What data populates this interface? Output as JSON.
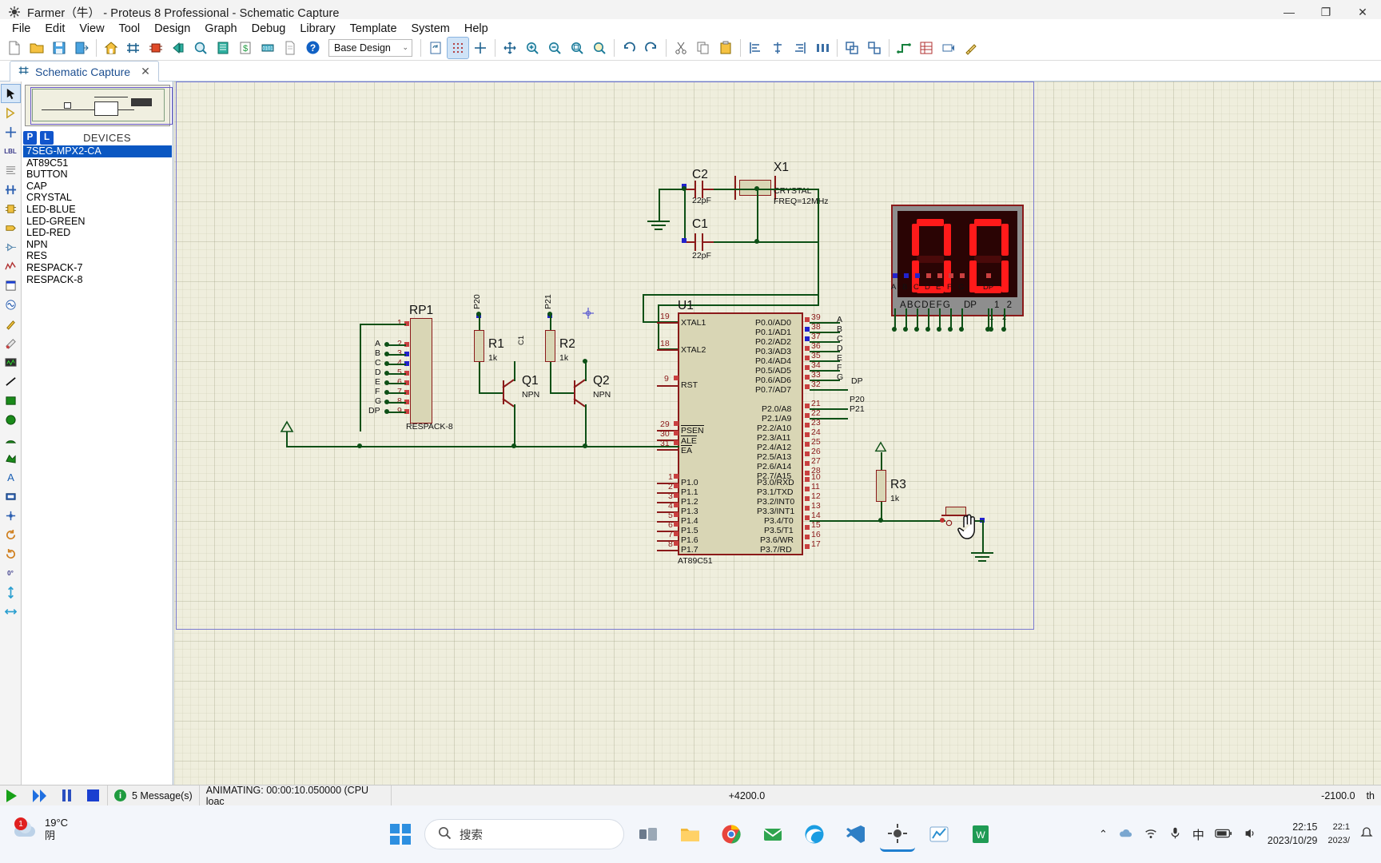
{
  "window": {
    "title": "Farmer（牛） - Proteus 8 Professional - Schematic Capture",
    "minimize": "—",
    "maximize": "❐",
    "close": "✕"
  },
  "menu": [
    "File",
    "Edit",
    "View",
    "Tool",
    "Design",
    "Graph",
    "Debug",
    "Library",
    "Template",
    "System",
    "Help"
  ],
  "toolbar": {
    "design_combo_value": "Base Design",
    "design_combo_arrow": "⌄"
  },
  "tab": {
    "label": "Schematic Capture",
    "close": "✕"
  },
  "panel": {
    "p_button": "P",
    "l_button": "L",
    "header": "DEVICES",
    "devices": [
      "7SEG-MPX2-CA",
      "AT89C51",
      "BUTTON",
      "CAP",
      "CRYSTAL",
      "LED-BLUE",
      "LED-GREEN",
      "LED-RED",
      "NPN",
      "RES",
      "RESPACK-7",
      "RESPACK-8"
    ],
    "selected_index": 0
  },
  "schematic": {
    "u1": {
      "ref": "U1",
      "value": "AT89C51",
      "left_pins": [
        {
          "num": "19",
          "name": "XTAL1"
        },
        {
          "num": "18",
          "name": "XTAL2"
        },
        {
          "num": "9",
          "name": "RST"
        },
        {
          "num": "29",
          "name": "PSEN"
        },
        {
          "num": "30",
          "name": "ALE"
        },
        {
          "num": "31",
          "name": "EA"
        },
        {
          "num": "1",
          "name": "P1.0"
        },
        {
          "num": "2",
          "name": "P1.1"
        },
        {
          "num": "3",
          "name": "P1.2"
        },
        {
          "num": "4",
          "name": "P1.3"
        },
        {
          "num": "5",
          "name": "P1.4"
        },
        {
          "num": "6",
          "name": "P1.5"
        },
        {
          "num": "7",
          "name": "P1.6"
        },
        {
          "num": "8",
          "name": "P1.7"
        }
      ],
      "port0": [
        {
          "num": "39",
          "name": "P0.0/AD0",
          "net": "A"
        },
        {
          "num": "38",
          "name": "P0.1/AD1",
          "net": "B"
        },
        {
          "num": "37",
          "name": "P0.2/AD2",
          "net": "C"
        },
        {
          "num": "36",
          "name": "P0.3/AD3",
          "net": "D"
        },
        {
          "num": "35",
          "name": "P0.4/AD4",
          "net": "E"
        },
        {
          "num": "34",
          "name": "P0.5/AD5",
          "net": "F"
        },
        {
          "num": "33",
          "name": "P0.6/AD6",
          "net": "G"
        },
        {
          "num": "32",
          "name": "P0.7/AD7",
          "net": "DP"
        }
      ],
      "port2": [
        {
          "num": "21",
          "name": "P2.0/A8",
          "net": "P20"
        },
        {
          "num": "22",
          "name": "P2.1/A9",
          "net": "P21"
        },
        {
          "num": "23",
          "name": "P2.2/A10",
          "net": ""
        },
        {
          "num": "24",
          "name": "P2.3/A11",
          "net": ""
        },
        {
          "num": "25",
          "name": "P2.4/A12",
          "net": ""
        },
        {
          "num": "26",
          "name": "P2.5/A13",
          "net": ""
        },
        {
          "num": "27",
          "name": "P2.6/A14",
          "net": ""
        },
        {
          "num": "28",
          "name": "P2.7/A15",
          "net": ""
        }
      ],
      "port3": [
        {
          "num": "10",
          "name": "P3.0/RXD"
        },
        {
          "num": "11",
          "name": "P3.1/TXD"
        },
        {
          "num": "12",
          "name": "P3.2/INT0"
        },
        {
          "num": "13",
          "name": "P3.3/INT1"
        },
        {
          "num": "14",
          "name": "P3.4/T0"
        },
        {
          "num": "15",
          "name": "P3.5/T1"
        },
        {
          "num": "16",
          "name": "P3.6/WR"
        },
        {
          "num": "17",
          "name": "P3.7/RD"
        }
      ]
    },
    "rp1": {
      "ref": "RP1",
      "value": "RESPACK-8",
      "pins": [
        {
          "num": "1",
          "net": ""
        },
        {
          "num": "2",
          "net": "A"
        },
        {
          "num": "3",
          "net": "B"
        },
        {
          "num": "4",
          "net": "C"
        },
        {
          "num": "5",
          "net": "D"
        },
        {
          "num": "6",
          "net": "E"
        },
        {
          "num": "7",
          "net": "F"
        },
        {
          "num": "8",
          "net": "G"
        },
        {
          "num": "9",
          "net": "DP"
        }
      ]
    },
    "c1": {
      "ref": "C1",
      "value": "22pF"
    },
    "c2": {
      "ref": "C2",
      "value": "22pF"
    },
    "x1": {
      "ref": "X1",
      "value": "CRYSTAL",
      "freq": "FREQ=12MHz"
    },
    "r1": {
      "ref": "R1",
      "value": "1k"
    },
    "r2": {
      "ref": "R2",
      "value": "1k"
    },
    "r3": {
      "ref": "R3",
      "value": "1k"
    },
    "q1": {
      "ref": "Q1",
      "value": "NPN"
    },
    "q2": {
      "ref": "Q2",
      "value": "NPN"
    },
    "net_p20": "P20",
    "net_p21": "P21",
    "display": {
      "segment_legend": "ABCDEFG",
      "dp_legend": "DP",
      "digit_legend": "1 2",
      "pin_labels": [
        "A",
        "B",
        "C",
        "D",
        "E",
        "F",
        "G",
        "DP"
      ],
      "digit_pin_labels": [
        "1",
        "2"
      ],
      "digits": [
        "0",
        "0"
      ]
    }
  },
  "statusbar": {
    "play": "▶",
    "step": "▶▶",
    "pause": "❙❙",
    "stop": "■",
    "info_glyph": "i",
    "messages": "5 Message(s)",
    "animating": "ANIMATING: 00:00:10.050000 (CPU loac",
    "coord_x": "+4200.0",
    "coord_y": "-2100.0",
    "coord_unit": "th"
  },
  "taskbar": {
    "temperature": "19°C",
    "condition": "阴",
    "weather_badge": "1",
    "search_placeholder": "搜索",
    "time": "22:15",
    "date": "2023/10/29",
    "tray_chevron": "⌃",
    "ime": "中",
    "clock_small_top": "22:1",
    "clock_small_bot": "2023/"
  }
}
